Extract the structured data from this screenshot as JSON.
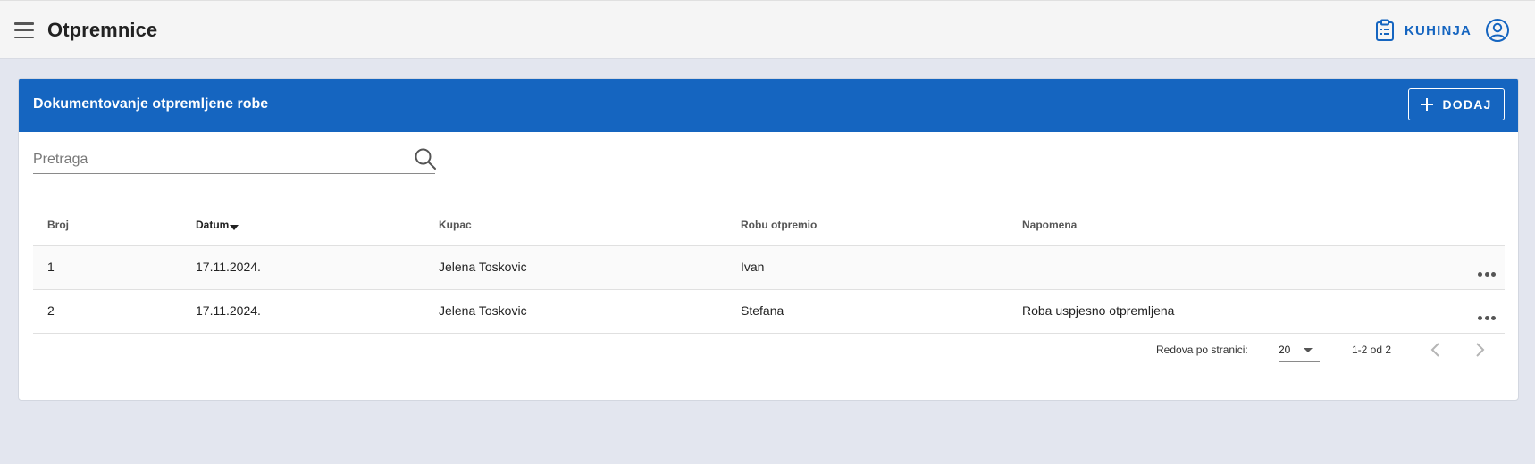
{
  "appbar": {
    "title": "Otpremnice",
    "kitchen_label": "KUHINJA",
    "icons": {
      "menu": "menu-icon",
      "kitchen": "clipboard-list-icon",
      "account": "account-circle-icon"
    },
    "accent_color": "#1565c0"
  },
  "card": {
    "title": "Dokumentovanje otpremljene robe",
    "add_label": "DODAJ",
    "header_color": "#1565c0"
  },
  "search": {
    "value": "",
    "placeholder": "Pretraga"
  },
  "table": {
    "columns": [
      "Broj",
      "Datum",
      "Kupac",
      "Robu otpremio",
      "Napomena"
    ],
    "sorted_column": "Datum",
    "rows": [
      {
        "broj": "1",
        "datum": "17.11.2024.",
        "kupac": "Jelena Toskovic",
        "robu_otpremio": "Ivan",
        "napomena": ""
      },
      {
        "broj": "2",
        "datum": "17.11.2024.",
        "kupac": "Jelena Toskovic",
        "robu_otpremio": "Stefana",
        "napomena": "Roba uspjesno otpremljena"
      }
    ]
  },
  "pagination": {
    "rows_per_page_label": "Redova po stranici:",
    "rows_per_page": "20",
    "range": "1-2 od 2"
  }
}
